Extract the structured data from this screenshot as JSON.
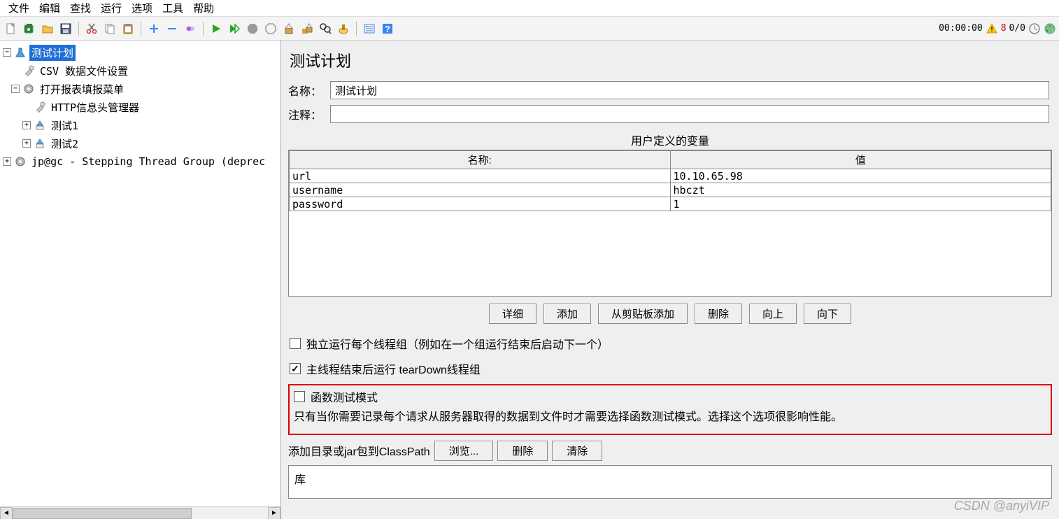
{
  "menu": {
    "items": [
      "文件",
      "编辑",
      "查找",
      "运行",
      "选项",
      "工具",
      "帮助"
    ]
  },
  "status": {
    "time": "00:00:00",
    "warn": "8",
    "threads": "0/0"
  },
  "tree": {
    "root": "测试计划",
    "csv": "CSV 数据文件设置",
    "menu_group": "打开报表填报菜单",
    "http_header": "HTTP信息头管理器",
    "test1": "测试1",
    "test2": "测试2",
    "stepping": "jp@gc - Stepping Thread Group (deprec"
  },
  "panel": {
    "title": "测试计划",
    "name_label": "名称：",
    "name_value": "测试计划",
    "comment_label": "注释：",
    "comment_value": "",
    "vars_title": "用户定义的变量",
    "col_name": "名称:",
    "col_value": "值",
    "rows": [
      {
        "name": "url",
        "value": "10.10.65.98"
      },
      {
        "name": "username",
        "value": "hbczt"
      },
      {
        "name": "password",
        "value": "1"
      }
    ],
    "btn_detail": "详细",
    "btn_add": "添加",
    "btn_clip": "从剪贴板添加",
    "btn_del": "删除",
    "btn_up": "向上",
    "btn_down": "向下",
    "cb_serial": "独立运行每个线程组（例如在一个组运行结束后启动下一个）",
    "cb_teardown": "主线程结束后运行 tearDown线程组",
    "cb_func": "函数测试模式",
    "func_note": "只有当你需要记录每个请求从服务器取得的数据到文件时才需要选择函数测试模式。选择这个选项很影响性能。",
    "classpath_label": "添加目录或jar包到ClassPath",
    "btn_browse": "浏览...",
    "btn_del2": "删除",
    "btn_clear": "清除",
    "lib_label": "库"
  },
  "watermark": "CSDN @anyiVIP"
}
